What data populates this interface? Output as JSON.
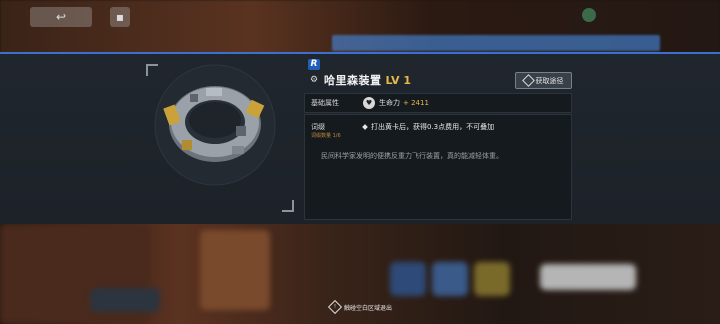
{
  "equipment": {
    "rarity": "R",
    "name": "哈里森装置",
    "level": "LV 1",
    "acquire_label": "获取途径",
    "base_attr_label": "基础属性",
    "stat_name": "生命力",
    "stat_value": "+ 2411",
    "entry_label": "词缀",
    "entry_count": "词缀数量 1/6",
    "effect": "打出黄卡后，获得0.3点费用，不可叠加",
    "flavor": "民间科学家发明的便携反重力飞行装置，真的能减轻体重。"
  },
  "hint": {
    "text": "触碰空白区域退出"
  },
  "icons": {
    "acquire": "diamond-icon",
    "stat": "heart-icon",
    "equipment_type": "accessory-icon",
    "hint": "exclamation-icon"
  },
  "colors": {
    "accent_gold": "#e8b84a",
    "rarity_blue": "#1f5fb8",
    "panel_bg": "#1c2228"
  }
}
